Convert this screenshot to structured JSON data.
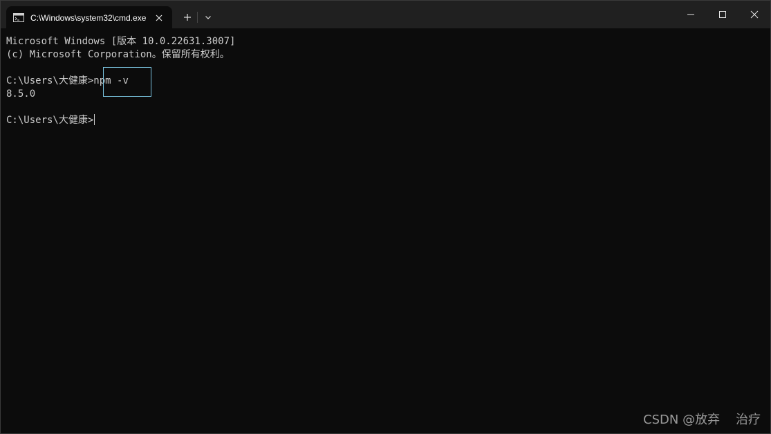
{
  "titlebar": {
    "tab_title": "C:\\Windows\\system32\\cmd.exe",
    "tab_icon": "terminal-icon",
    "close_tab_icon": "close-icon",
    "new_tab_icon": "plus-icon",
    "dropdown_icon": "chevron-down-icon",
    "window_buttons": [
      "minimize-icon",
      "maximize-icon",
      "close-icon"
    ]
  },
  "console": {
    "lines": [
      "Microsoft Windows [版本 10.0.22631.3007]",
      "(c) Microsoft Corporation。保留所有权利。",
      "",
      "C:\\Users\\大健康>",
      "8.5.0",
      "",
      "C:\\Users\\大健康>"
    ],
    "command": "npm -v",
    "highlight_color": "#7ac4e0",
    "text_color": "#cccccc",
    "background_color": "#0c0c0c"
  },
  "watermark": {
    "text": "CSDN @放弃    治疗"
  }
}
